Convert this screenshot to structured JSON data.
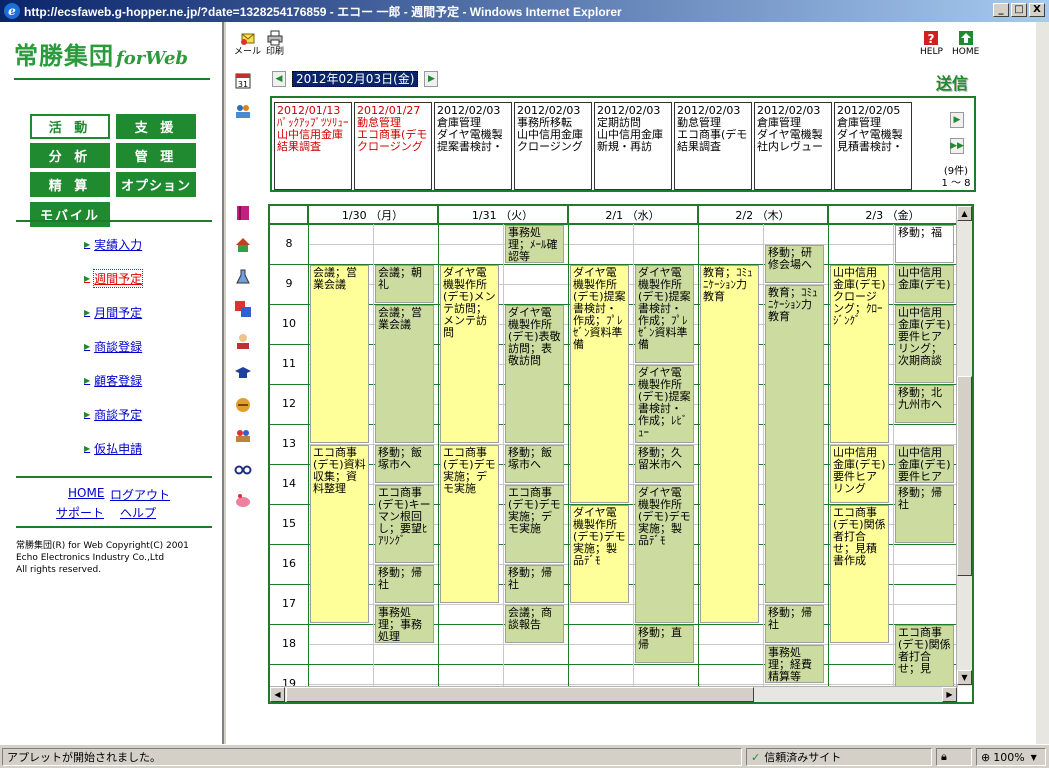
{
  "window": {
    "title": "http://ecsfaweb.g-hopper.ne.jp/?date=1328254176859 - エコー 一郎 - 週間予定 - Windows Internet Explorer",
    "btn_min": "_",
    "btn_max": "□",
    "btn_close": "X"
  },
  "colors": {
    "brand_green": "#1f8a30",
    "event_yellow": "#ffff99",
    "event_green": "#ccdca0",
    "link_blue": "#0000cc",
    "current_red": "#e00000"
  },
  "left": {
    "logo_jp": "常勝集団",
    "logo_en": "forWeb",
    "menu": [
      {
        "label": "活 動",
        "active": true
      },
      {
        "label": "支 援",
        "active": false
      },
      {
        "label": "分 析",
        "active": false
      },
      {
        "label": "管 理",
        "active": false
      },
      {
        "label": "精 算",
        "active": false
      },
      {
        "label": "オプション",
        "active": false
      },
      {
        "label": "モバイル",
        "active": false
      }
    ],
    "nav": [
      {
        "label": "実績入力",
        "current": false
      },
      {
        "label": "週間予定",
        "current": true
      },
      {
        "label": "月間予定",
        "current": false
      },
      {
        "label": "商談登録",
        "current": false
      },
      {
        "label": "顧客登録",
        "current": false
      },
      {
        "label": "商談予定",
        "current": false
      },
      {
        "label": "仮払申請",
        "current": false
      }
    ],
    "bottom_links": {
      "home": "HOME",
      "logout": "ログアウト",
      "support": "サポート",
      "help": "ヘルプ"
    },
    "copyright": [
      "常勝集団(R) for Web Copyright(C) 2001",
      "Echo Electronics Industry Co.,Ltd",
      "All rights reserved."
    ]
  },
  "toolbar": {
    "mail": "メール",
    "print": "印刷",
    "help": "HELP",
    "home": "HOME",
    "send": "送信"
  },
  "date_nav": {
    "current": "2012年02月03日(金)"
  },
  "events": {
    "count": "(9件)",
    "range": "1 ～ 8",
    "cards": [
      {
        "date": "2012/01/13",
        "line1": "ﾊﾟｯｸｱｯﾌﾟﾂｿﾘｭｰ",
        "line2": "山中信用金庫",
        "line3": "結果調査",
        "red": true
      },
      {
        "date": "2012/01/27",
        "line1": "勤怠管理",
        "line2": "エコ商事(デモ",
        "line3": "クロージング",
        "red": true
      },
      {
        "date": "2012/02/03",
        "line1": "倉庫管理",
        "line2": "ダイヤ電機製",
        "line3": "提案書検討・",
        "red": false
      },
      {
        "date": "2012/02/03",
        "line1": "事務所移転",
        "line2": "山中信用金庫",
        "line3": "クロージング",
        "red": false
      },
      {
        "date": "2012/02/03",
        "line1": "定期訪問",
        "line2": "山中信用金庫",
        "line3": "新規・再訪",
        "red": false
      },
      {
        "date": "2012/02/03",
        "line1": "勤怠管理",
        "line2": "エコ商事(デモ",
        "line3": "結果調査",
        "red": false
      },
      {
        "date": "2012/02/03",
        "line1": "倉庫管理",
        "line2": "ダイヤ電機製",
        "line3": "社内レヴュー",
        "red": false
      },
      {
        "date": "2012/02/05",
        "line1": "倉庫管理",
        "line2": "ダイヤ電機製",
        "line3": "見積書検討・",
        "red": false
      }
    ]
  },
  "schedule": {
    "days": [
      "1/30 （月）",
      "1/31 （火）",
      "2/1 （水）",
      "2/2 （木）",
      "2/3 （金）"
    ],
    "hours": [
      "8",
      "9",
      "10",
      "11",
      "12",
      "13",
      "14",
      "15",
      "16",
      "17",
      "18",
      "19"
    ],
    "events": [
      {
        "col": 0,
        "sub": 0,
        "start": 8.5,
        "end": 13,
        "color": "y",
        "text": "会議；営業会議"
      },
      {
        "col": 0,
        "sub": 0,
        "start": 13,
        "end": 17.5,
        "color": "y",
        "text": "エコ商事(デモ)資料収集；資料整理"
      },
      {
        "col": 0,
        "sub": 1,
        "start": 8.5,
        "end": 9.5,
        "color": "g",
        "text": "会議；朝礼"
      },
      {
        "col": 0,
        "sub": 1,
        "start": 9.5,
        "end": 13,
        "color": "g",
        "text": "会議；営業会議"
      },
      {
        "col": 0,
        "sub": 1,
        "start": 13,
        "end": 14,
        "color": "g",
        "text": "移動；飯塚市へ"
      },
      {
        "col": 0,
        "sub": 1,
        "start": 14,
        "end": 16,
        "color": "g",
        "text": "エコ商事(デモ)キーマン根回し；要望ﾋｱﾘﾝｸﾞ"
      },
      {
        "col": 0,
        "sub": 1,
        "start": 16,
        "end": 17,
        "color": "g",
        "text": "移動；帰社"
      },
      {
        "col": 0,
        "sub": 1,
        "start": 17,
        "end": 18,
        "color": "g",
        "text": "事務処理；事務処理"
      },
      {
        "col": 1,
        "sub": 0,
        "start": 8.5,
        "end": 13,
        "color": "y",
        "text": "ダイヤ電機製作所(デモ)メンテ訪問；メンテ訪問"
      },
      {
        "col": 1,
        "sub": 0,
        "start": 13,
        "end": 17,
        "color": "y",
        "text": "エコ商事(デモ)デモ実施；デモ実施"
      },
      {
        "col": 1,
        "sub": 1,
        "start": 7.5,
        "end": 8.5,
        "color": "g",
        "text": "事務処理；ﾒｰﾙ確認等"
      },
      {
        "col": 1,
        "sub": 1,
        "start": 9.5,
        "end": 13,
        "color": "g",
        "text": "ダイヤ電機製作所(デモ)表敬訪問；表敬訪問"
      },
      {
        "col": 1,
        "sub": 1,
        "start": 13,
        "end": 14,
        "color": "g",
        "text": "移動；飯塚市へ"
      },
      {
        "col": 1,
        "sub": 1,
        "start": 14,
        "end": 16,
        "color": "g",
        "text": "エコ商事(デモ)デモ実施；デモ実施"
      },
      {
        "col": 1,
        "sub": 1,
        "start": 16,
        "end": 17,
        "color": "g",
        "text": "移動；帰社"
      },
      {
        "col": 1,
        "sub": 1,
        "start": 17,
        "end": 18,
        "color": "g",
        "text": "会議；商談報告"
      },
      {
        "col": 2,
        "sub": 0,
        "start": 8.5,
        "end": 14.5,
        "color": "y",
        "text": "ダイヤ電機製作所(デモ)提案書検討・作成；ﾌﾟﾚｾﾞﾝ資料準備"
      },
      {
        "col": 2,
        "sub": 0,
        "start": 14.5,
        "end": 17,
        "color": "y",
        "text": "ダイヤ電機製作所(デモ)デモ実施；製品ﾃﾞﾓ"
      },
      {
        "col": 2,
        "sub": 1,
        "start": 8.5,
        "end": 11,
        "color": "g",
        "text": "ダイヤ電機製作所(デモ)提案書検討・作成；ﾌﾟﾚｾﾞﾝ資料準備"
      },
      {
        "col": 2,
        "sub": 1,
        "start": 11,
        "end": 13,
        "color": "g",
        "text": "ダイヤ電機製作所(デモ)提案書検討・作成；ﾚﾋﾞｭｰ"
      },
      {
        "col": 2,
        "sub": 1,
        "start": 13,
        "end": 14,
        "color": "g",
        "text": "移動；久留米市へ"
      },
      {
        "col": 2,
        "sub": 1,
        "start": 14,
        "end": 17.5,
        "color": "g",
        "text": "ダイヤ電機製作所(デモ)デモ実施；製品ﾃﾞﾓ"
      },
      {
        "col": 2,
        "sub": 1,
        "start": 17.5,
        "end": 18.5,
        "color": "g",
        "text": "移動；直帰"
      },
      {
        "col": 3,
        "sub": 0,
        "start": 8.5,
        "end": 17.5,
        "color": "y",
        "text": "教育；ｺﾐｭﾆｹｰｼｮﾝ力教育"
      },
      {
        "col": 3,
        "sub": 1,
        "start": 8,
        "end": 9,
        "color": "g",
        "text": "移動；研修会場へ"
      },
      {
        "col": 3,
        "sub": 1,
        "start": 9,
        "end": 17,
        "color": "g",
        "text": "教育；ｺﾐｭﾆｹｰｼｮﾝ力教育"
      },
      {
        "col": 3,
        "sub": 1,
        "start": 17,
        "end": 18,
        "color": "g",
        "text": "移動；帰社"
      },
      {
        "col": 3,
        "sub": 1,
        "start": 18,
        "end": 19,
        "color": "g",
        "text": "事務処理；経費精算等"
      },
      {
        "col": 4,
        "sub": 0,
        "start": 8.5,
        "end": 13,
        "color": "y",
        "text": "山中信用金庫(デモ)クロージング；ｸﾛｰｼﾞﾝｸﾞ"
      },
      {
        "col": 4,
        "sub": 0,
        "start": 13,
        "end": 14.5,
        "color": "y",
        "text": "山中信用金庫(デモ)要件ヒアリング"
      },
      {
        "col": 4,
        "sub": 0,
        "start": 14.5,
        "end": 18,
        "color": "y",
        "text": "エコ商事(デモ)関係者打合せ；見積書作成"
      },
      {
        "col": 4,
        "sub": 1,
        "start": 7.5,
        "end": 8.5,
        "color": "w",
        "text": "移動；福"
      },
      {
        "col": 4,
        "sub": 1,
        "start": 8.5,
        "end": 9.5,
        "color": "g",
        "text": "山中信用金庫(デモ)"
      },
      {
        "col": 4,
        "sub": 1,
        "start": 9.5,
        "end": 11.5,
        "color": "g",
        "text": "山中信用金庫(デモ)要件ヒアリング；次期商談"
      },
      {
        "col": 4,
        "sub": 1,
        "start": 11.5,
        "end": 12.5,
        "color": "g",
        "text": "移動；北九州市へ"
      },
      {
        "col": 4,
        "sub": 1,
        "start": 13,
        "end": 14,
        "color": "g",
        "text": "山中信用金庫(デモ)要件ヒア"
      },
      {
        "col": 4,
        "sub": 1,
        "start": 14,
        "end": 15.5,
        "color": "g",
        "text": "移動；帰社"
      },
      {
        "col": 4,
        "sub": 1,
        "start": 17.5,
        "end": 19.5,
        "color": "g",
        "text": "エコ商事(デモ)関係者打合せ；見"
      }
    ]
  },
  "statusbar": {
    "message": "アプレットが開始されました。",
    "trusted": "信頼済みサイト",
    "zoom": "100%"
  }
}
